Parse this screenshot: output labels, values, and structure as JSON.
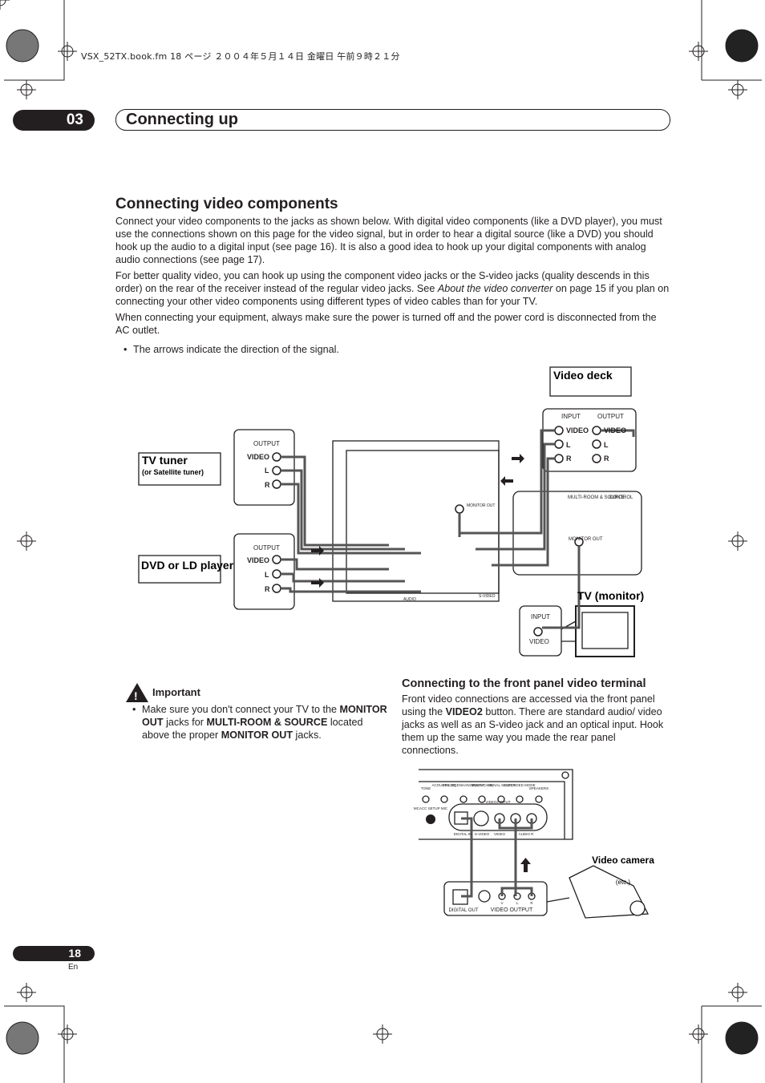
{
  "file_info": "VSX_52TX.book.fm 18 ページ ２００４年５月１４日 金曜日 午前９時２１分",
  "chapter": {
    "number": "03",
    "title": "Connecting up"
  },
  "section": {
    "title": "Connecting video components",
    "paragraphs": [
      "Connect your video components to the jacks as shown below. With digital video components (like a DVD player), you must use the connections shown on this page for the video signal, but in order to hear a digital source (like a DVD) you should hook up the audio to a digital input (see page 16). It is also a good idea to hook up your digital components with analog audio connections (see page 17).",
      "When connecting your equipment, always make sure the power is turned off and the power cord is disconnected from the AC outlet."
    ],
    "p2_a": "For better quality video, you can hook up using the component video jacks or the S-video jacks (quality descends in this order) on the rear of the receiver instead of the regular video jacks. See ",
    "p2_em": "About the video converter",
    "p2_b": " on page 15 if you plan on connecting your other video components using different types of video cables than for your TV.",
    "bullet": "The arrows indicate the direction of the signal."
  },
  "diagram": {
    "tv_tuner": "TV tuner",
    "tv_tuner_sub": "(or Satellite tuner)",
    "dvd": "DVD or LD player",
    "video_deck": "Video deck",
    "tv_monitor": "TV (monitor)",
    "output": "OUTPUT",
    "input": "INPUT",
    "video": "VIDEO",
    "l": "L",
    "r": "R",
    "monitor_out": "MONITOR OUT",
    "multi_room": "MULTI-ROOM & SOURCE",
    "control": "CONTROL",
    "s_video": "S-VIDEO",
    "audio": "AUDIO"
  },
  "important": {
    "title": "Important",
    "t1": "Make sure you don't connect your TV to the ",
    "b1": "MONITOR OUT",
    "t2": " jacks for ",
    "b2": "MULTI-ROOM & SOURCE",
    "t3": " located above the proper ",
    "b3": "MONITOR OUT",
    "t4": " jacks."
  },
  "front": {
    "title": "Connecting to the front panel video terminal",
    "t1": "Front video connections are accessed via the front panel using the ",
    "b1": "VIDEO2",
    "t2": " button. There are standard audio/ video jacks as well as an S-video jack and an optical input. Hook them up the same way you made the rear panel connections.",
    "knobs": [
      "TONE",
      "ACOUSTIC EQ",
      "DIALOG ENHANCEMENT",
      "MULTI-CH IN",
      "SIGNAL SELECT",
      "EXTENDED MODE",
      "SPEAKERS"
    ],
    "mic": "MCACC SETUP MIC",
    "video2_input": "VIDEO2 INPUT",
    "jacks": [
      "DIGITAL IN",
      "S-VIDEO",
      "VIDEO",
      "AUDIO  R"
    ],
    "digital_out": "DIGITAL OUT",
    "video_output": "VIDEO OUTPUT",
    "cam_jacks": [
      "V",
      "L",
      "R"
    ],
    "camera": "Video camera",
    "camera_sub": "(etc.)"
  },
  "page": {
    "number": "18",
    "lang": "En"
  }
}
